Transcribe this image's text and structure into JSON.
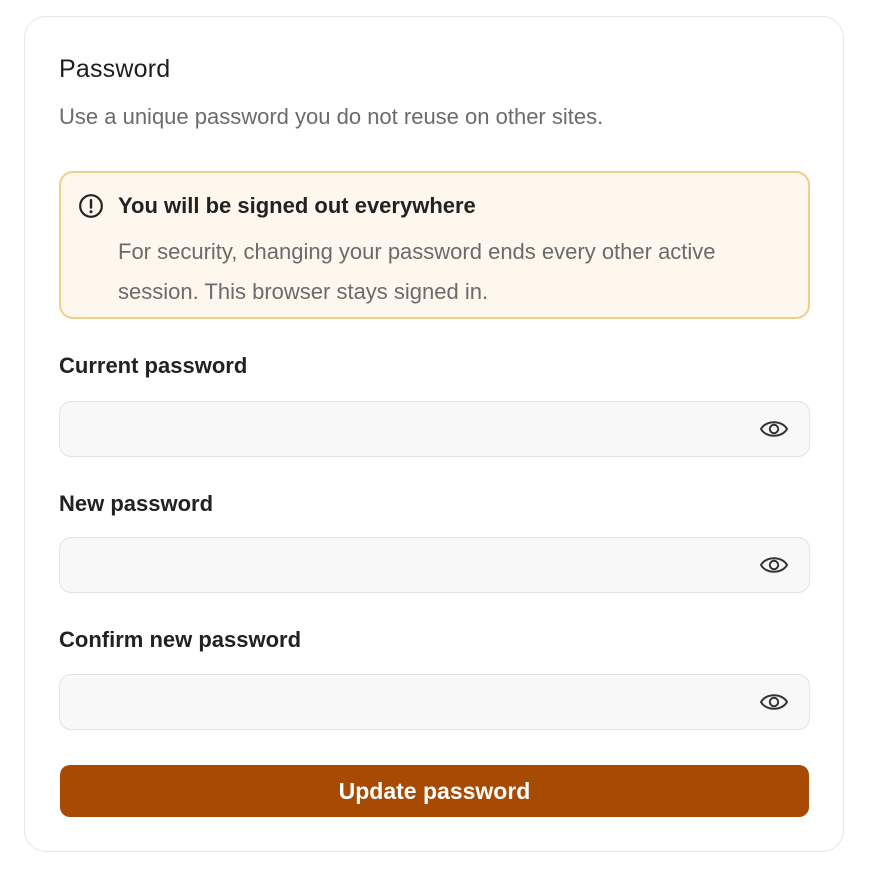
{
  "section": {
    "title": "Password",
    "subtitle": "Use a unique password you do not reuse on other sites."
  },
  "alert": {
    "icon": "exclamation-circle-icon",
    "title": "You will be signed out everywhere",
    "body": "For security, changing your password ends every other active session. This browser stays signed in."
  },
  "fields": [
    {
      "label": "Current password",
      "value": "",
      "placeholder": "",
      "icon": "eye-icon"
    },
    {
      "label": "New password",
      "value": "",
      "placeholder": "",
      "icon": "eye-icon"
    },
    {
      "label": "Confirm new password",
      "value": "",
      "placeholder": "",
      "icon": "eye-icon"
    }
  ],
  "submit": {
    "label": "Update password"
  },
  "colors": {
    "accent": "#a64a04",
    "alert_bg": "#fdf7ee",
    "alert_border": "#f0cf8a"
  }
}
